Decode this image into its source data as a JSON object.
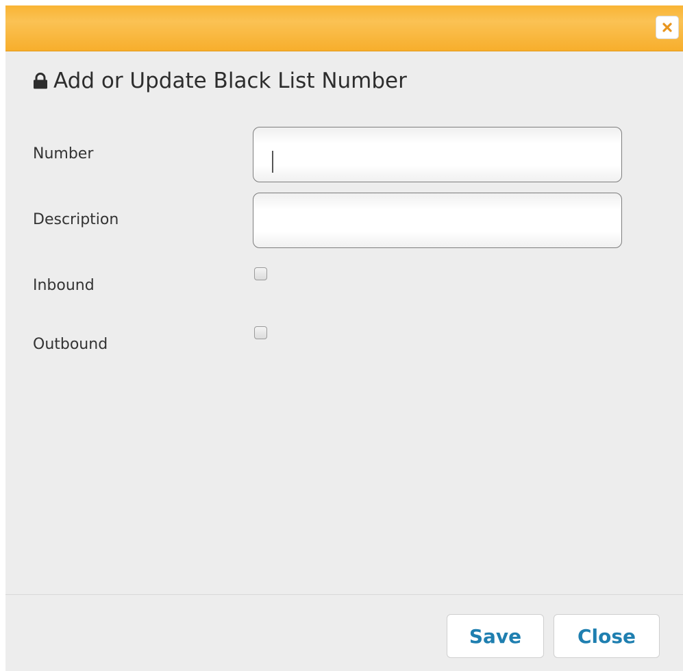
{
  "dialog": {
    "title": "Add or Update Black List Number",
    "title_icon": "lock-icon",
    "close_icon": "close-icon",
    "colors": {
      "titlebar": "#f9b434",
      "close_glyph": "#e8951e",
      "button_text": "#1f7fb0",
      "background": "#ededed"
    }
  },
  "form": {
    "number": {
      "label": "Number",
      "value": ""
    },
    "description": {
      "label": "Description",
      "value": ""
    },
    "inbound": {
      "label": "Inbound",
      "checked": false
    },
    "outbound": {
      "label": "Outbound",
      "checked": false
    }
  },
  "buttons": {
    "save_label": "Save",
    "close_label": "Close"
  }
}
